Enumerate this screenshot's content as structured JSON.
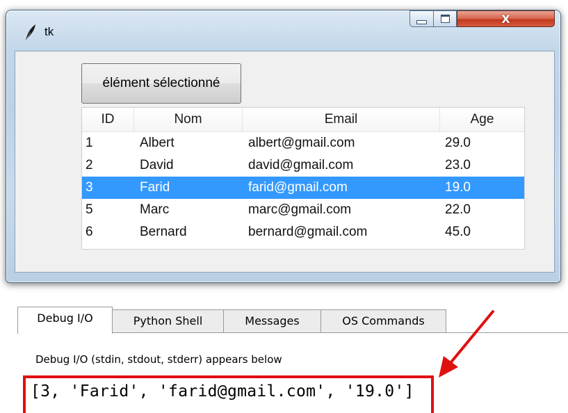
{
  "window": {
    "title": "tk",
    "close_glyph": "X",
    "button_label": "élément sélectionné"
  },
  "tree": {
    "columns": [
      "ID",
      "Nom",
      "Email",
      "Age"
    ],
    "rows": [
      {
        "id": "1",
        "nom": "Albert",
        "email": "albert@gmail.com",
        "age": "29.0"
      },
      {
        "id": "2",
        "nom": "David",
        "email": "david@gmail.com",
        "age": "23.0"
      },
      {
        "id": "3",
        "nom": "Farid",
        "email": "farid@gmail.com",
        "age": "19.0",
        "selected": true
      },
      {
        "id": "5",
        "nom": "Marc",
        "email": "marc@gmail.com",
        "age": "22.0"
      },
      {
        "id": "6",
        "nom": "Bernard",
        "email": "bernard@gmail.com",
        "age": "45.0"
      }
    ],
    "selection_color": "#3399ff"
  },
  "debug_panel": {
    "tabs": [
      {
        "label": "Debug I/O",
        "active": true
      },
      {
        "label": "Python Shell"
      },
      {
        "label": "Messages"
      },
      {
        "label": "OS Commands"
      }
    ],
    "description": "Debug I/O (stdin, stdout, stderr) appears below",
    "output": "[3, 'Farid', 'farid@gmail.com', '19.0']",
    "highlight_color": "#e01010"
  },
  "icons": [
    "feather-icon",
    "minimize-icon",
    "maximize-icon",
    "close-icon",
    "arrow-annotation-icon"
  ]
}
